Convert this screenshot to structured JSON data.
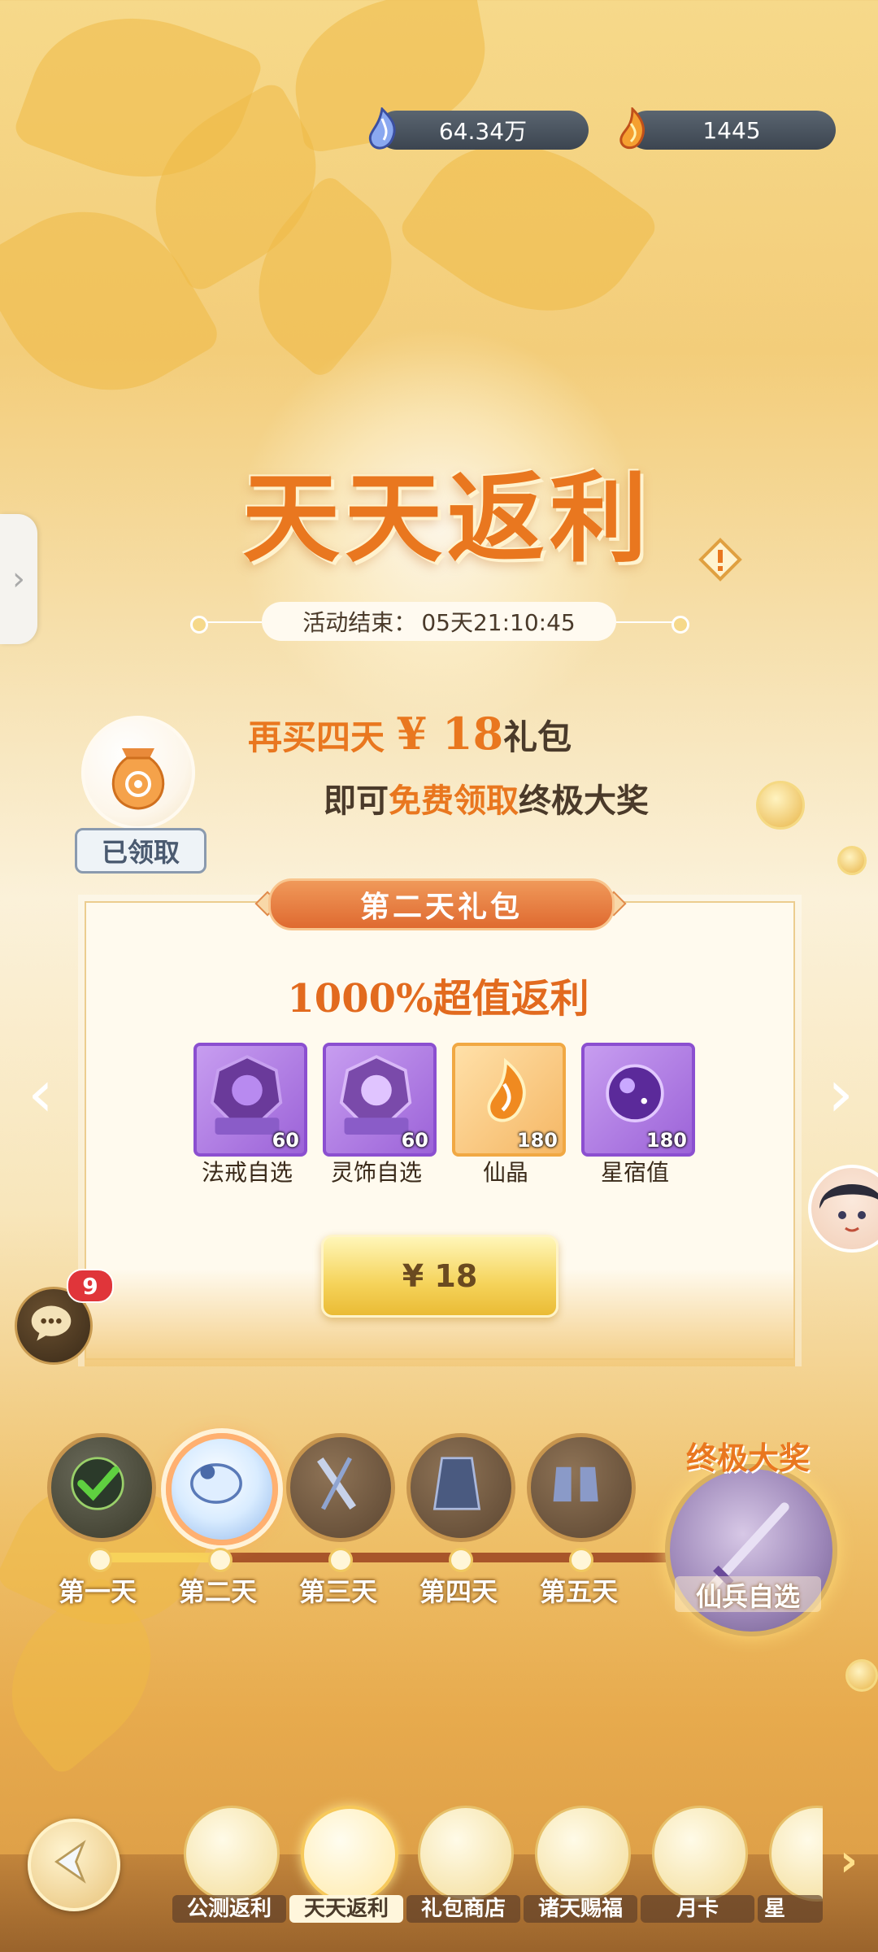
{
  "currency": {
    "jade": {
      "icon": "blue-jade-icon",
      "value": "64.34万"
    },
    "crystal": {
      "icon": "fire-crystal-icon",
      "value": "1445"
    }
  },
  "header": {
    "title": "天天返利",
    "countdown_label": "活动结束：",
    "countdown_value": "05天21:10:45"
  },
  "promo": {
    "line1_prefix": "再买四天",
    "line1_price": "¥ 18",
    "line1_suffix": "礼包",
    "line2_prefix": "即可",
    "line2_accent": "免费领取",
    "line2_suffix": "终极大奖",
    "claimed_label": "已领取"
  },
  "panel": {
    "ribbon": "第二天礼包",
    "rebate": "1000%超值返利",
    "items": [
      {
        "name": "法戒自选",
        "qty": "60",
        "rarity": "purple"
      },
      {
        "name": "灵饰自选",
        "qty": "60",
        "rarity": "purple"
      },
      {
        "name": "仙晶",
        "qty": "180",
        "rarity": "orange"
      },
      {
        "name": "星宿值",
        "qty": "180",
        "rarity": "purple"
      }
    ],
    "buy_label": "¥ 18"
  },
  "chat": {
    "badge": "9"
  },
  "days": [
    {
      "label": "第一天",
      "state": "done"
    },
    {
      "label": "第二天",
      "state": "active"
    },
    {
      "label": "第三天",
      "state": "locked"
    },
    {
      "label": "第四天",
      "state": "locked"
    },
    {
      "label": "第五天",
      "state": "locked"
    }
  ],
  "progress_fraction": 0.22,
  "final_reward": {
    "title": "终极大奖",
    "label": "仙兵自选"
  },
  "nav": [
    {
      "label": "公测返利",
      "selected": false
    },
    {
      "label": "天天返利",
      "selected": true
    },
    {
      "label": "礼包商店",
      "selected": false
    },
    {
      "label": "诸天赐福",
      "selected": false
    },
    {
      "label": "月卡",
      "selected": false
    },
    {
      "label": "星",
      "selected": false
    }
  ],
  "colors": {
    "accent": "#e9771f",
    "gold": "#f5d35a",
    "purple": "#9c63d8",
    "badge": "#e0353a"
  }
}
